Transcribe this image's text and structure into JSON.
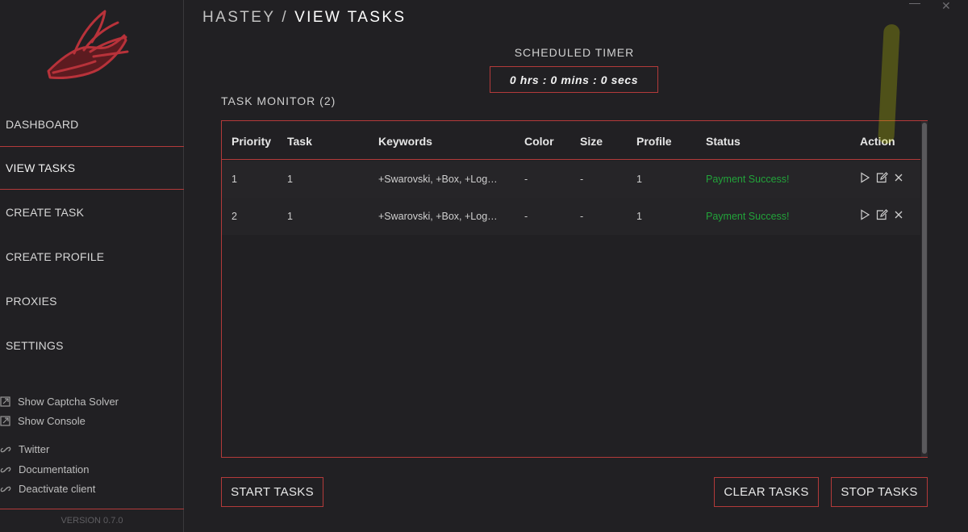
{
  "colors": {
    "accent": "#b33a3a",
    "status_success": "#22a33a",
    "background": "#212023"
  },
  "sidebar": {
    "logo": "winged-shoe-logo",
    "nav": [
      {
        "label": "DASHBOARD",
        "active": false
      },
      {
        "label": "VIEW TASKS",
        "active": true
      },
      {
        "label": "CREATE TASK",
        "active": false
      },
      {
        "label": "CREATE PROFILE",
        "active": false
      },
      {
        "label": "PROXIES",
        "active": false
      },
      {
        "label": "SETTINGS",
        "active": false
      }
    ],
    "windows": [
      {
        "label": "Show Captcha Solver",
        "icon": "external-link-icon"
      },
      {
        "label": "Show Console",
        "icon": "external-link-icon"
      }
    ],
    "links": [
      {
        "label": "Twitter",
        "icon": "link-icon"
      },
      {
        "label": "Documentation",
        "icon": "link-icon"
      },
      {
        "label": "Deactivate client",
        "icon": "link-icon"
      }
    ],
    "version": "VERSION 0.7.0"
  },
  "header": {
    "app": "HASTEY",
    "separator": "/",
    "page": "VIEW TASKS"
  },
  "timer": {
    "label": "SCHEDULED TIMER",
    "value": "0 hrs : 0 mins : 0 secs"
  },
  "monitor": {
    "title": "TASK MONITOR (2)",
    "columns": [
      "Priority",
      "Task",
      "Keywords",
      "Color",
      "Size",
      "Profile",
      "Status",
      "Action"
    ],
    "rows": [
      {
        "priority": "1",
        "task": "1",
        "keywords": "+Swarovski, +Box, +Log…",
        "color": "-",
        "size": "-",
        "profile": "1",
        "status": "Payment Success!"
      },
      {
        "priority": "2",
        "task": "1",
        "keywords": "+Swarovski, +Box, +Log…",
        "color": "-",
        "size": "-",
        "profile": "1",
        "status": "Payment Success!"
      }
    ],
    "row_actions": [
      "play-icon",
      "edit-icon",
      "close-icon"
    ]
  },
  "buttons": {
    "start": "START TASKS",
    "clear": "CLEAR TASKS",
    "stop": "STOP TASKS"
  }
}
